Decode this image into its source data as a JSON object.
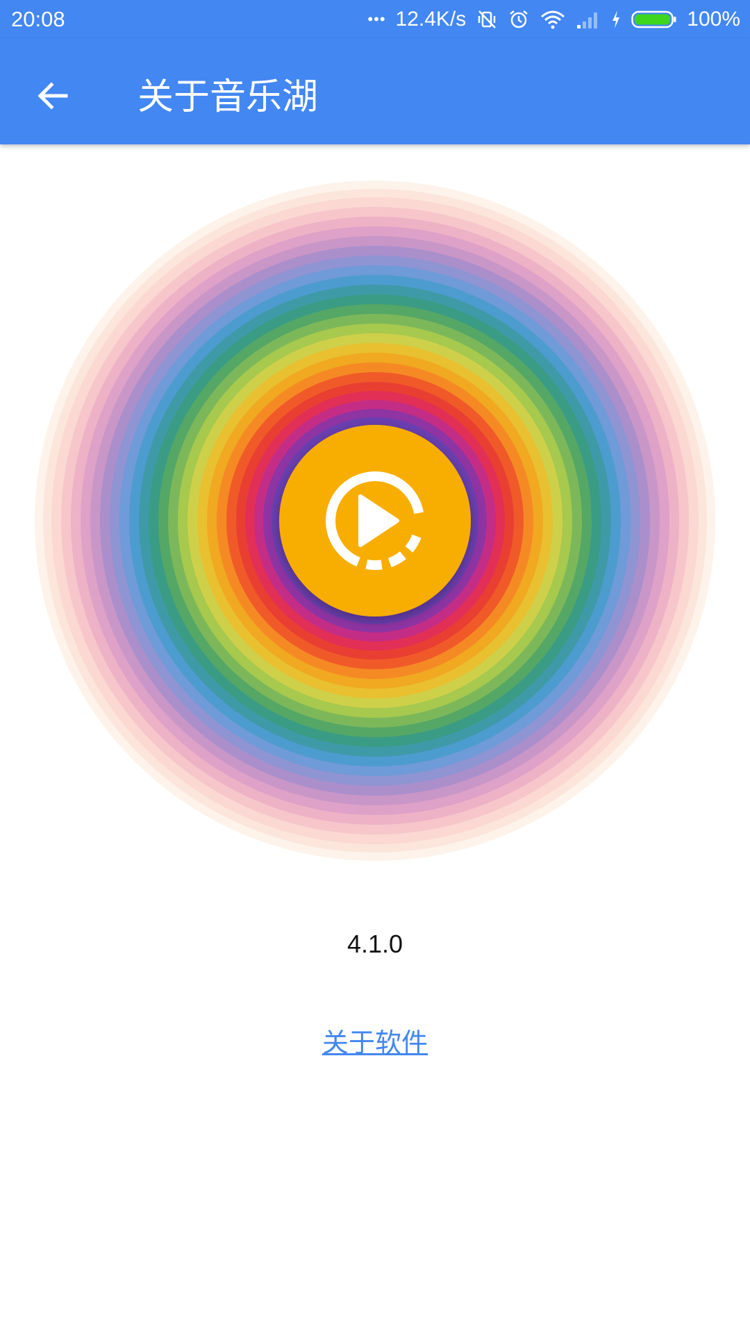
{
  "status_bar": {
    "time": "20:08",
    "more_dots": "•••",
    "net_speed": "12.4K/s",
    "battery_percent": "100%",
    "icons": [
      "vibrate-off-icon",
      "alarm-icon",
      "wifi-icon",
      "signal-icon",
      "charging-icon",
      "battery-icon"
    ],
    "battery_level": 1.0
  },
  "app_bar": {
    "back_icon": "arrow-left-icon",
    "title": "关于音乐湖"
  },
  "logo": {
    "icon": "play-circle-icon",
    "center_color": "#f8ae00",
    "play_color": "#ffffff"
  },
  "version": "4.1.0",
  "about_link": "关于软件",
  "colors": {
    "primary": "#4287f2",
    "background": "#ffffff",
    "link": "#4287f2"
  }
}
